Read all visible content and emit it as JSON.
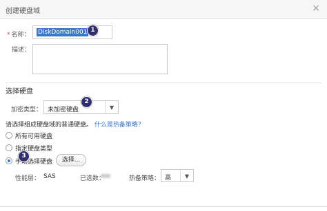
{
  "dialog": {
    "title": "创建硬盘域",
    "close_glyph": "×"
  },
  "form": {
    "name_required_mark": "*",
    "name_label": "名称：",
    "name_value": "DiskDomain001",
    "description_label": "描述："
  },
  "badges": [
    "1",
    "2",
    "3"
  ],
  "disk_section": {
    "title": "选择硬盘",
    "encryption_label": "加密类型：",
    "encryption_value": "未加密硬盘",
    "prompt_text": "请选择组成硬盘域的普通硬盘。",
    "hotspare_link": "什么是热备策略？",
    "options": [
      {
        "label": "所有可用硬盘",
        "selected": false
      },
      {
        "label": "指定硬盘类型",
        "selected": false
      },
      {
        "label": "手动选择硬盘",
        "selected": true
      }
    ],
    "select_button": "选择..."
  },
  "summary": {
    "tier_label": "性能层：",
    "tier_value": "SAS",
    "selected_label": "已选数：",
    "hotspare_label": "热备策略：",
    "hotspare_value": "高"
  },
  "colors": {
    "accent": "#3a78c9",
    "badge": "#2f2f6f",
    "required": "#e04040"
  }
}
